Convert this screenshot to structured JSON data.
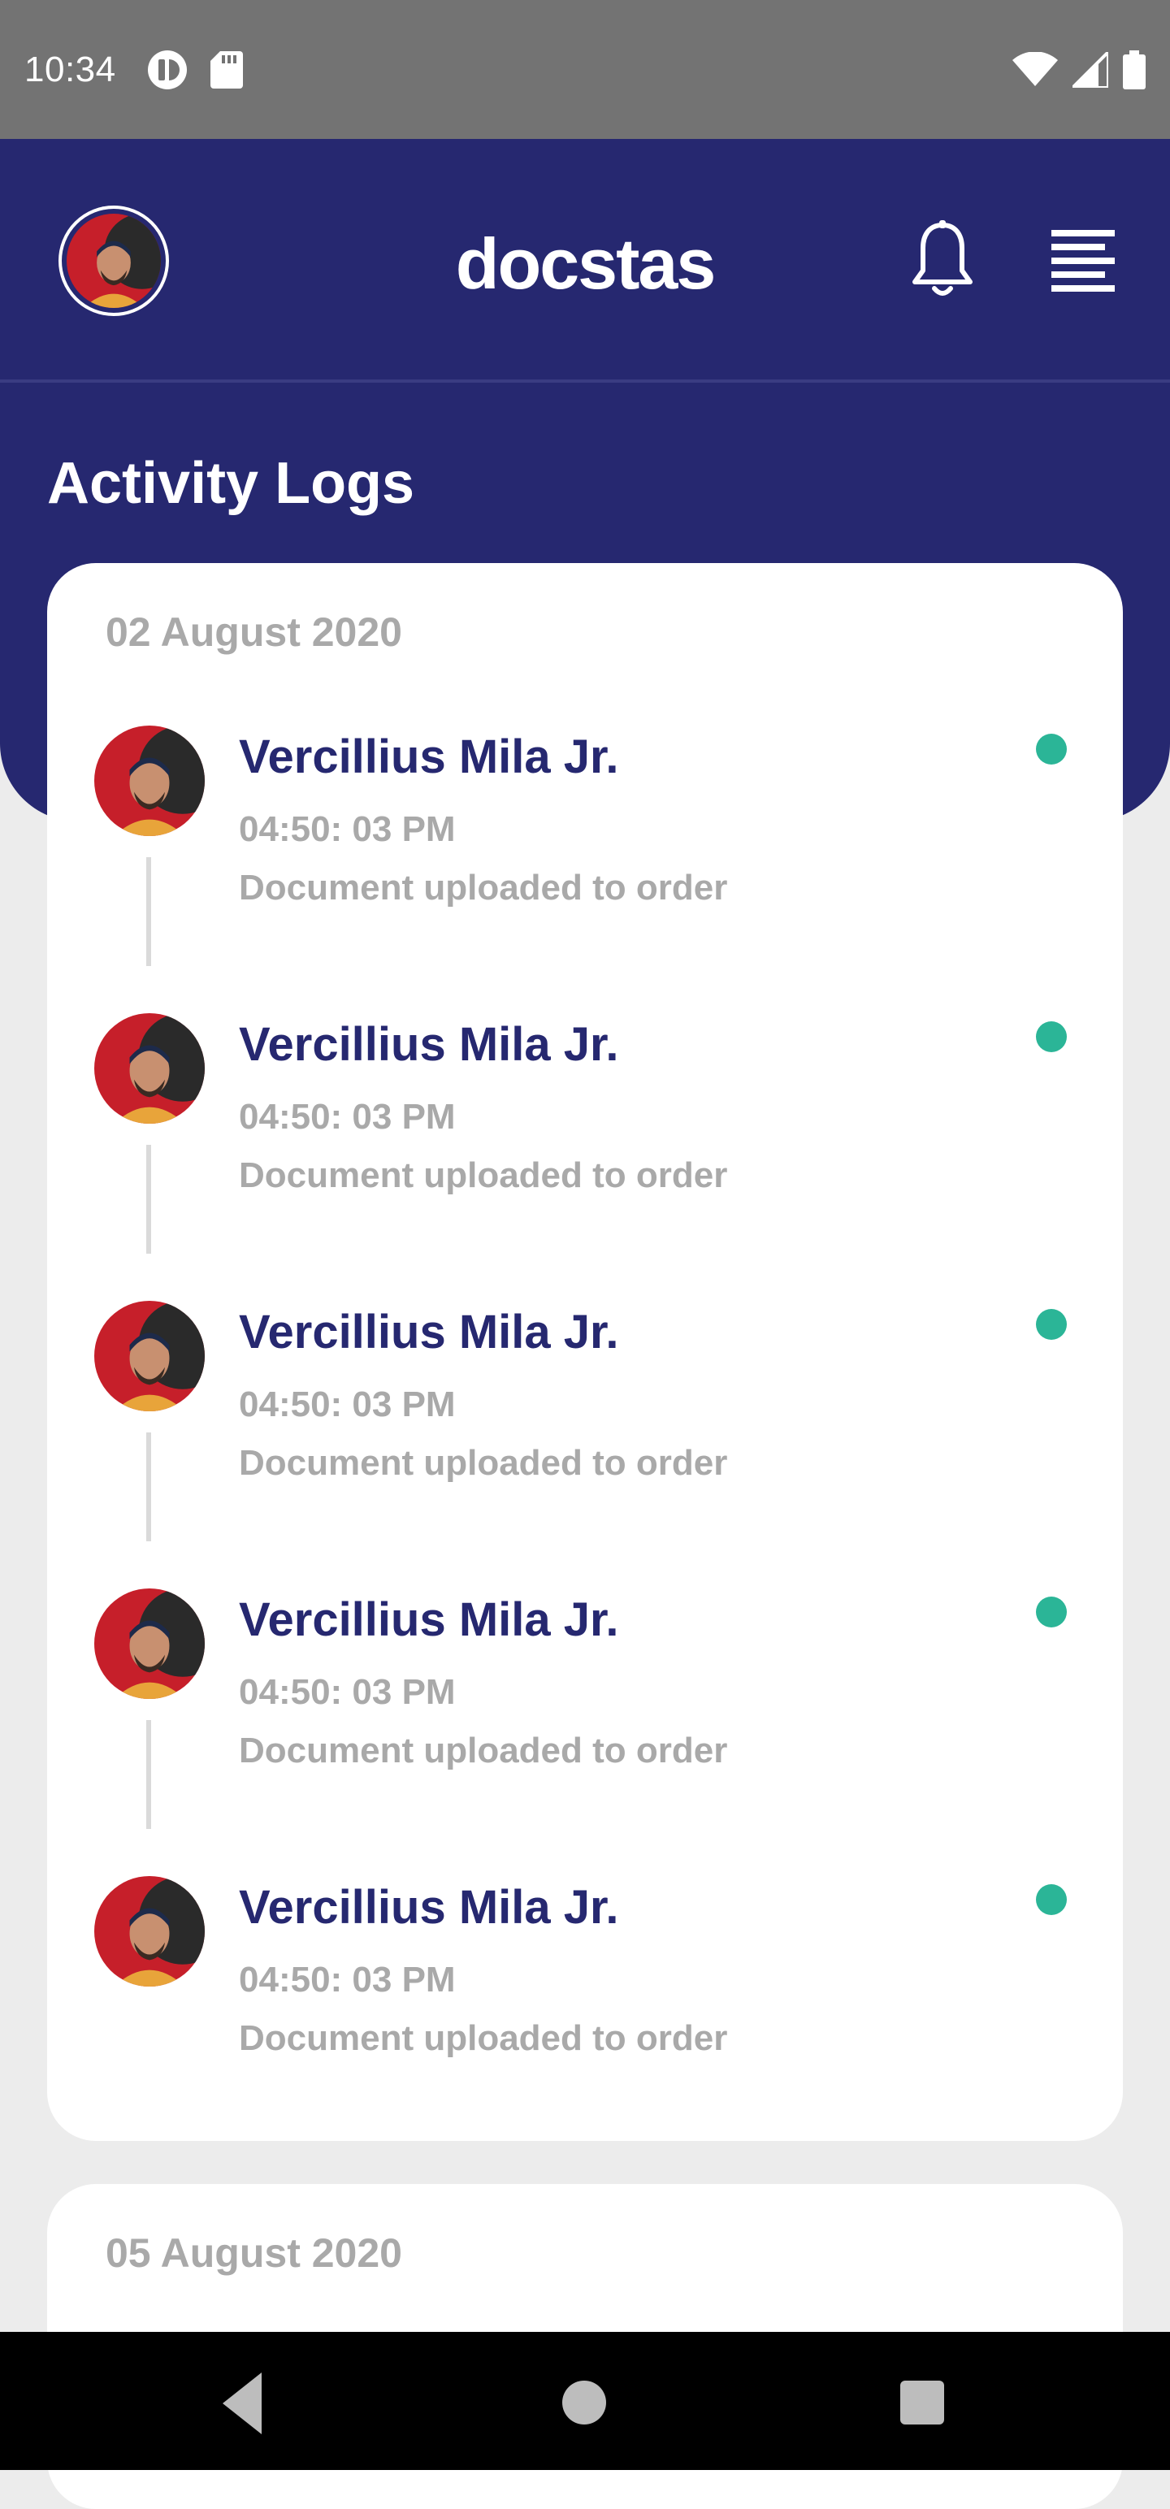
{
  "status_bar": {
    "time": "10:34"
  },
  "header": {
    "app_title": "docstas"
  },
  "page": {
    "title": "Activity Logs"
  },
  "groups": [
    {
      "date": "02 August 2020",
      "logs": [
        {
          "name": "Vercillius Mila Jr.",
          "time": "04:50: 03 PM",
          "description": "Document uploaded to order"
        },
        {
          "name": "Vercillius Mila Jr.",
          "time": "04:50: 03 PM",
          "description": "Document uploaded to order"
        },
        {
          "name": "Vercillius Mila Jr.",
          "time": "04:50: 03 PM",
          "description": "Document uploaded to order"
        },
        {
          "name": "Vercillius Mila Jr.",
          "time": "04:50: 03 PM",
          "description": "Document uploaded to order"
        },
        {
          "name": "Vercillius Mila Jr.",
          "time": "04:50: 03 PM",
          "description": "Document uploaded to order"
        }
      ]
    },
    {
      "date": "05 August 2020",
      "logs": []
    }
  ],
  "colors": {
    "brand": "#262870",
    "online_dot": "#2bb597",
    "muted_text": "#a9a9a9"
  }
}
